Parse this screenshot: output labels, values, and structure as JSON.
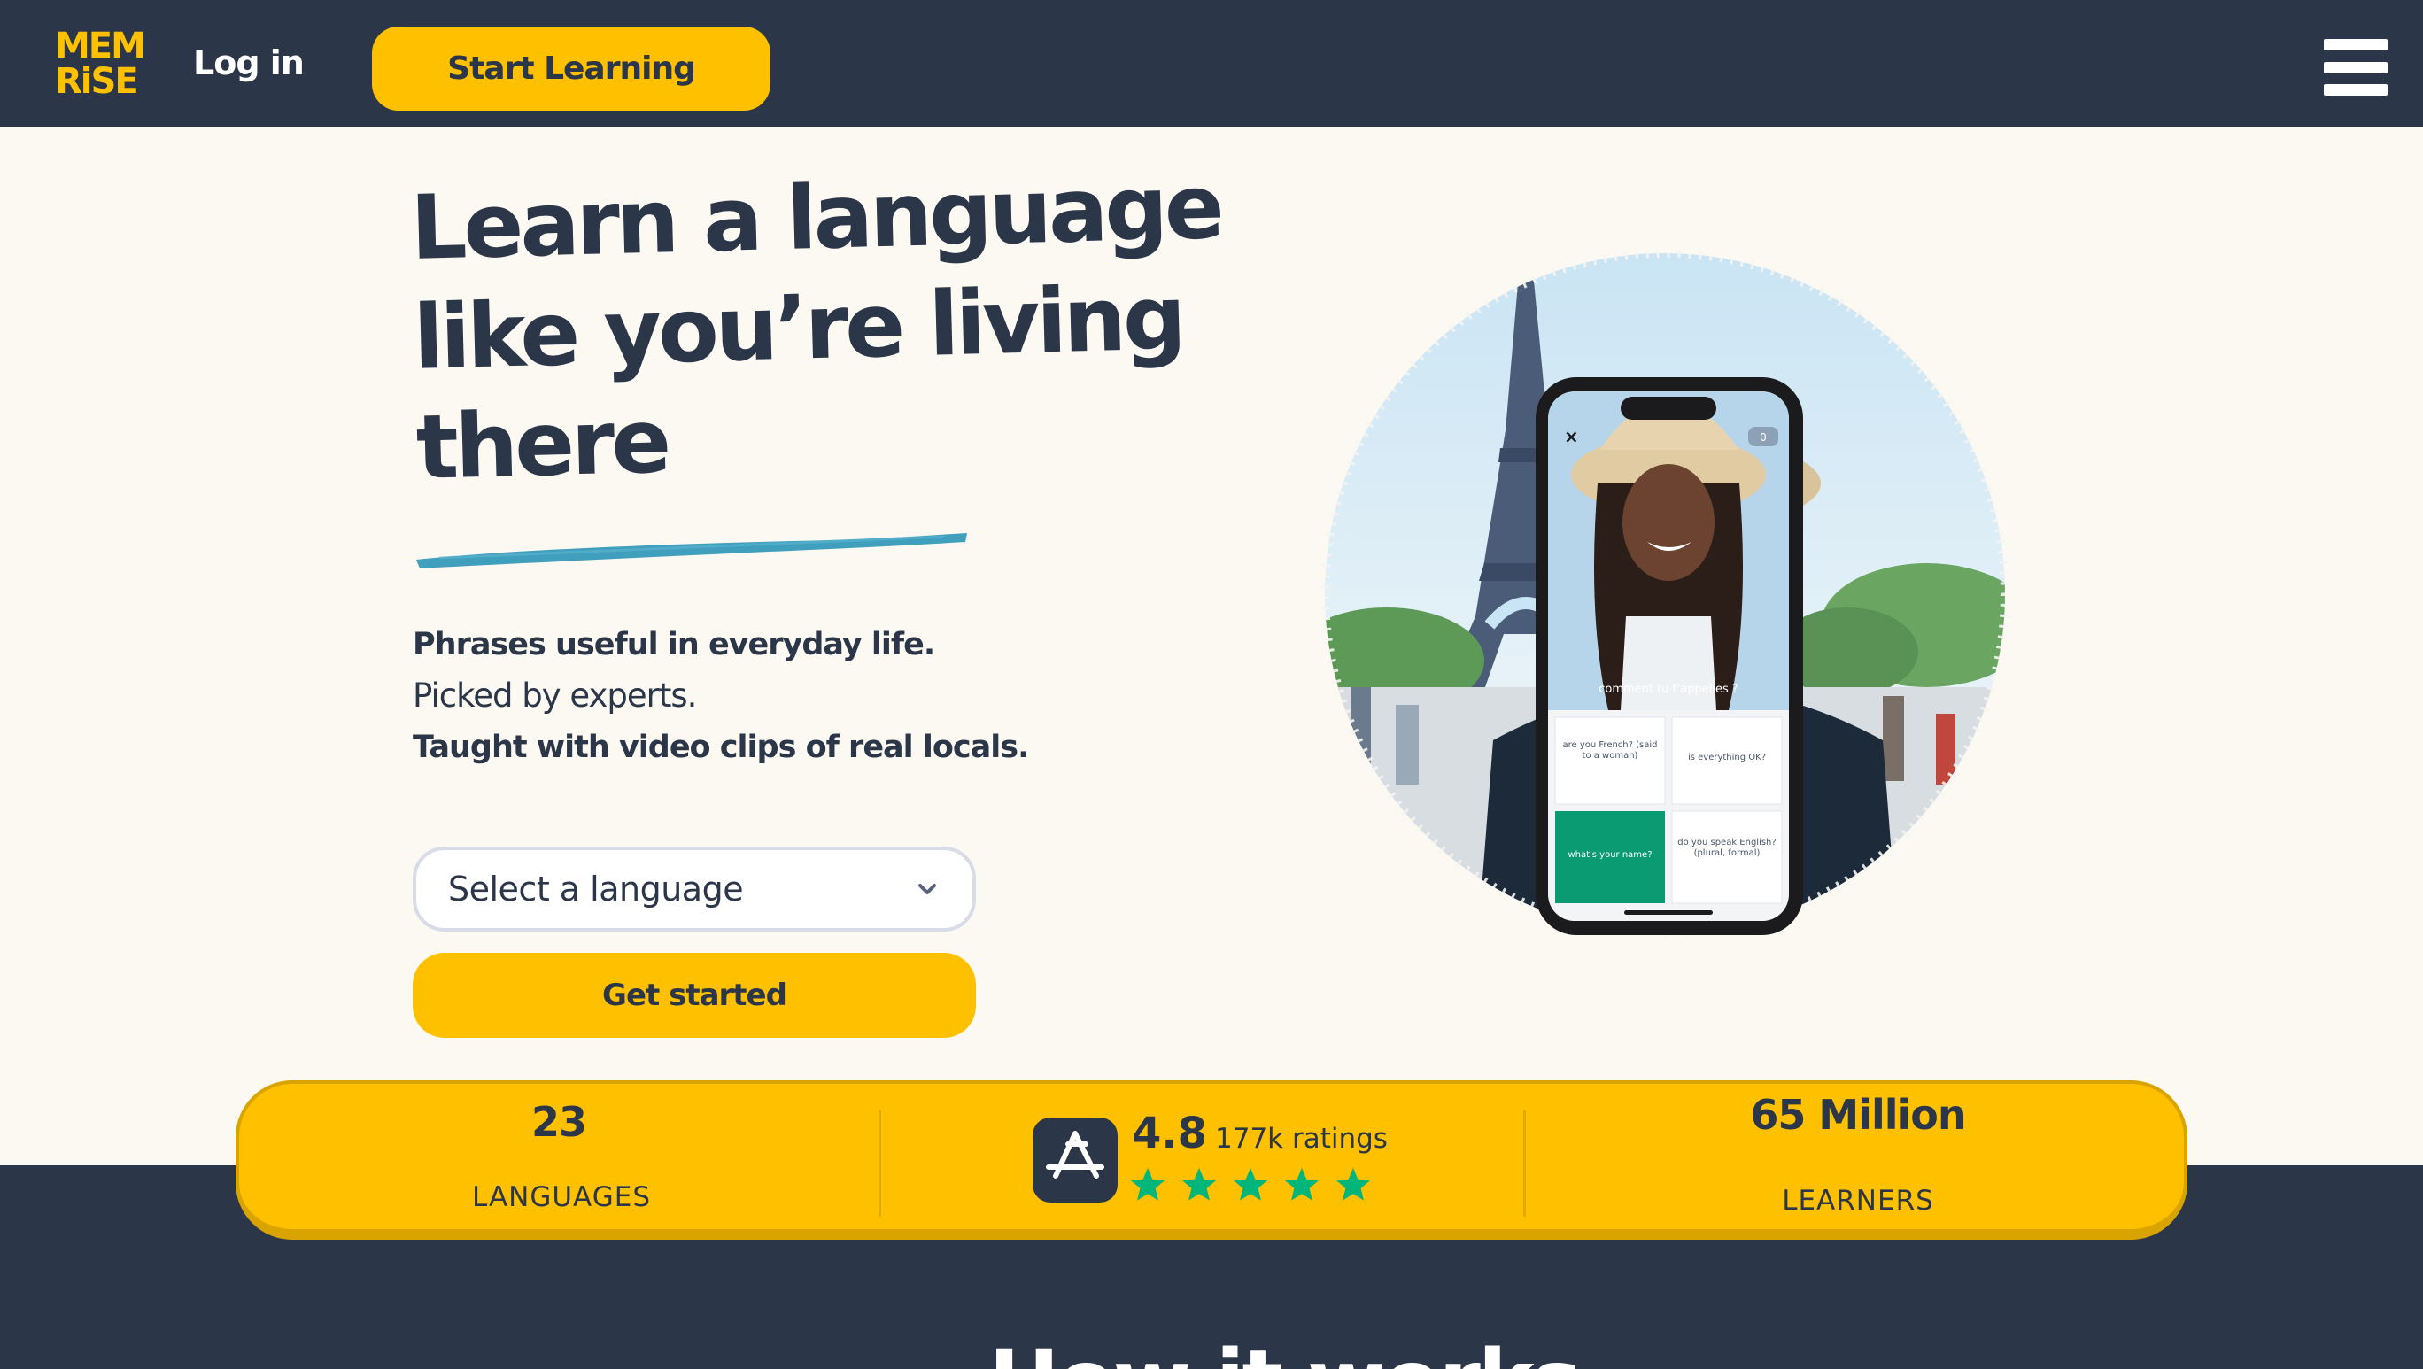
{
  "colors": {
    "navy": "#2b3648",
    "brand_yellow": "#ffc000",
    "cream_background": "#fcf9f2",
    "brush_underline": "#3f9fbd",
    "star_green": "#00b67a",
    "answer_highlight": "#0b9b72"
  },
  "nav": {
    "logo_line1": "MEM",
    "logo_line2": "RiSE",
    "login_label": "Log in",
    "start_learning_label": "Start Learning",
    "menu_icon": "hamburger-menu-icon"
  },
  "hero": {
    "title_line1": "Learn a language",
    "title_line2": "like you’re living",
    "title_line3": "there",
    "tagline1": "Phrases useful in everyday life.",
    "tagline2": "Picked by experts.",
    "tagline3": "Taught with video clips of real locals.",
    "language_select_placeholder": "Select a language",
    "get_started_label": "Get started"
  },
  "phone": {
    "close_symbol": "×",
    "counter": "0",
    "prompt": "comment tu t'appelles ?",
    "options": [
      "are you French? (said to a woman)",
      "is everything OK?",
      "what's your name?",
      "do you speak English? (plural, formal)"
    ],
    "selected_option": 2
  },
  "stats": {
    "languages_count": "23",
    "languages_label": "LANGUAGES",
    "rating": "4.8",
    "ratings_count": "177k ratings",
    "stars": 5,
    "learners_count": "65 Million",
    "learners_label": "LEARNERS",
    "appstore_icon": "app-store-icon",
    "star_icon": "star-icon"
  },
  "next_section": {
    "heading_partial": "How it works"
  }
}
